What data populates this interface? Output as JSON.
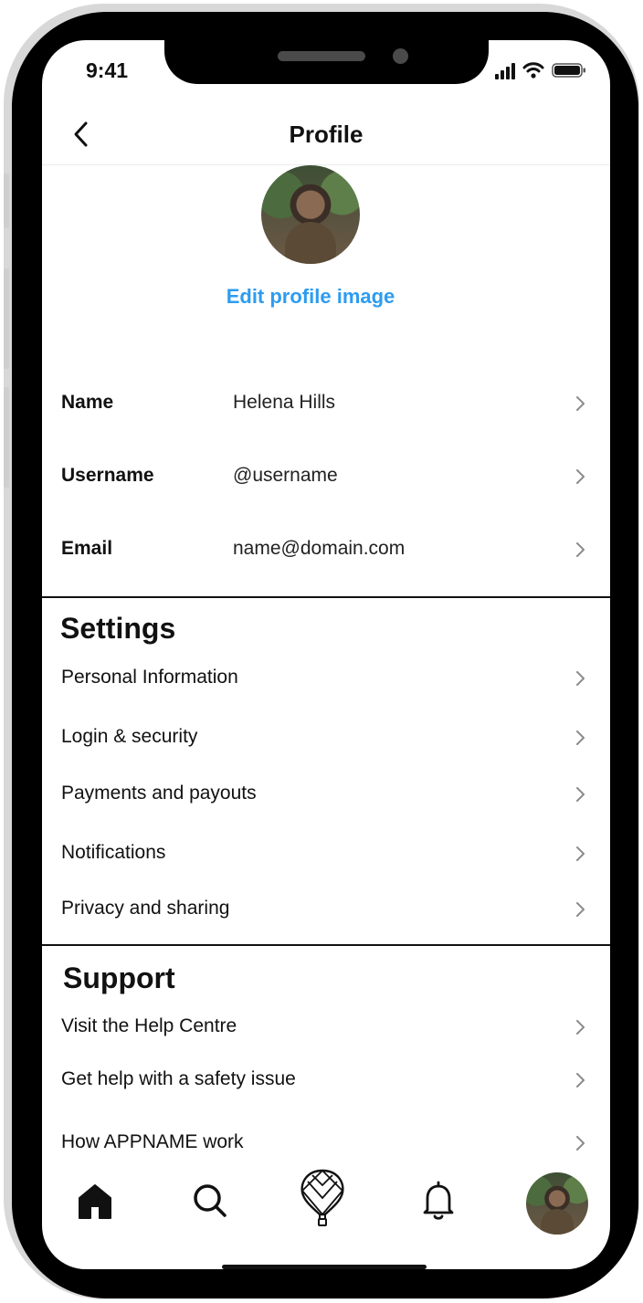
{
  "status_bar": {
    "time": "9:41"
  },
  "header": {
    "title": "Profile"
  },
  "profile": {
    "edit_image_label": "Edit profile image"
  },
  "fields": [
    {
      "label": "Name",
      "value": "Helena Hills"
    },
    {
      "label": "Username",
      "value": "@username"
    },
    {
      "label": "Email",
      "value": "name@domain.com"
    }
  ],
  "settings": {
    "title": "Settings",
    "items": [
      "Personal Information",
      "Login & security",
      "Payments and payouts",
      "Notifications",
      "Privacy and sharing"
    ]
  },
  "support": {
    "title": "Support",
    "items": [
      "Visit the Help Centre",
      "Get help with a safety issue",
      "How APPNAME work"
    ]
  },
  "tab_bar": {
    "icons": [
      "home-icon",
      "search-icon",
      "balloon-icon",
      "bell-icon",
      "profile-avatar"
    ]
  },
  "colors": {
    "link": "#2d9cf0",
    "text": "#111111",
    "chevron": "#8a8a8a"
  }
}
